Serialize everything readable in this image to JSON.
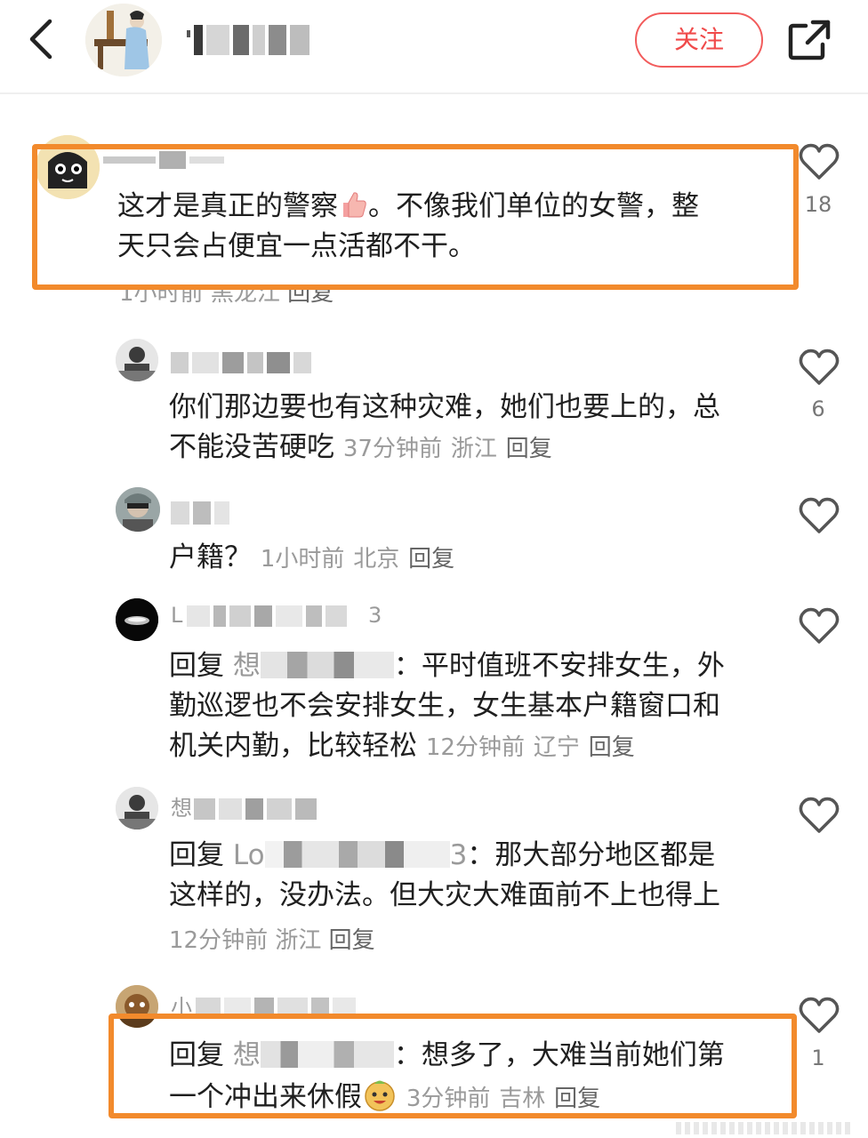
{
  "header": {
    "follow_label": "关注"
  },
  "comments": [
    {
      "line1": "这才是真正的警察",
      "line1_after": "。不像我们单位的女警，整",
      "line2": "天只会占便宜一点活都不干。",
      "time": "1小时前",
      "location": "黑龙江",
      "reply": "回复",
      "likes": "18"
    },
    {
      "line1": "你们那边要也有这种灾难，她们也要上的，总",
      "line2": "不能没苦硬吃",
      "time": "37分钟前",
      "location": "浙江",
      "reply": "回复",
      "likes": "6"
    },
    {
      "line1": "户籍？",
      "time": "1小时前",
      "location": "北京",
      "reply": "回复",
      "likes": ""
    },
    {
      "name_visible": "L",
      "name_tail": "3",
      "reply_prefix": "回复",
      "reply_target": "想",
      "line1_rest": "：平时值班不安排女生，外",
      "line2": "勤巡逻也不会安排女生，女生基本户籍窗口和",
      "line3": "机关内勤，比较轻松",
      "time": "12分钟前",
      "location": "辽宁",
      "reply": "回复",
      "likes": ""
    },
    {
      "name_visible": "想",
      "reply_prefix": "回复",
      "reply_target": "Lo",
      "reply_target_tail": "3",
      "line1_rest": "：那大部分地区都是",
      "line2": "这样的，没办法。但大灾大难面前不上也得上",
      "time": "12分钟前",
      "location": "浙江",
      "reply": "回复",
      "likes": ""
    },
    {
      "name_visible": "小",
      "reply_prefix": "回复",
      "reply_target": "想",
      "line1_rest": "：想多了，大难当前她们第",
      "line2": "一个冲出来休假",
      "time": "3分钟前",
      "location": "吉林",
      "reply": "回复",
      "likes": "1"
    }
  ]
}
